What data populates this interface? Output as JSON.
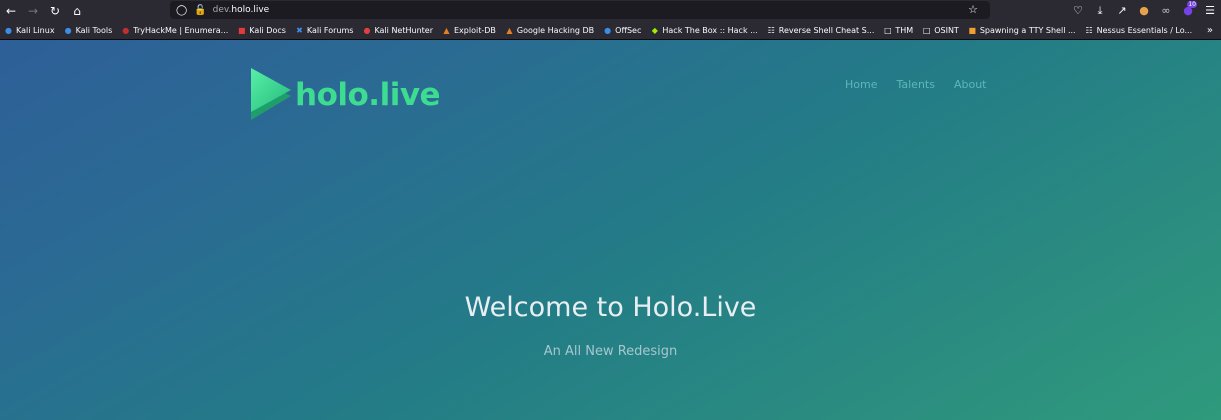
{
  "browser": {
    "url_subdomain": "dev.",
    "url_domain": "holo.live",
    "bookmarks": [
      {
        "label": "Kali Linux",
        "icon": "kali-dragon-icon",
        "color": "#3a8ee6"
      },
      {
        "label": "Kali Tools",
        "icon": "kali-tools-icon",
        "color": "#3a8ee6"
      },
      {
        "label": "TryHackMe | Enumera...",
        "icon": "tryhackme-icon",
        "color": "#c12f2f"
      },
      {
        "label": "Kali Docs",
        "icon": "kali-docs-icon",
        "color": "#e03a3a"
      },
      {
        "label": "Kali Forums",
        "icon": "kali-forums-icon",
        "color": "#3a8ee6"
      },
      {
        "label": "Kali NetHunter",
        "icon": "kali-nethunter-icon",
        "color": "#e04040"
      },
      {
        "label": "Exploit-DB",
        "icon": "exploit-db-icon",
        "color": "#e67e22"
      },
      {
        "label": "Google Hacking DB",
        "icon": "ghdb-icon",
        "color": "#e67e22"
      },
      {
        "label": "OffSec",
        "icon": "offsec-icon",
        "color": "#3a8ee6"
      },
      {
        "label": "Hack The Box :: Hack ...",
        "icon": "hackthebox-icon",
        "color": "#9fef00"
      },
      {
        "label": "Reverse Shell Cheat S...",
        "icon": "globe-icon",
        "color": "#fbfbfe"
      },
      {
        "label": "THM",
        "icon": "folder-icon",
        "color": "#fbfbfe"
      },
      {
        "label": "OSINT",
        "icon": "folder-icon",
        "color": "#fbfbfe"
      },
      {
        "label": "Spawning a TTY Shell ...",
        "icon": "shell-icon",
        "color": "#f0a030"
      },
      {
        "label": "Nessus Essentials / Lo...",
        "icon": "globe-icon",
        "color": "#fbfbfe"
      }
    ],
    "extension_badge": "10"
  },
  "site": {
    "logo_text": "holo.live",
    "logo_color": "#3ddc91",
    "nav": [
      "Home",
      "Talents",
      "About"
    ],
    "hero_title": "Welcome to Holo.Live",
    "hero_subtitle": "An All New Redesign"
  }
}
